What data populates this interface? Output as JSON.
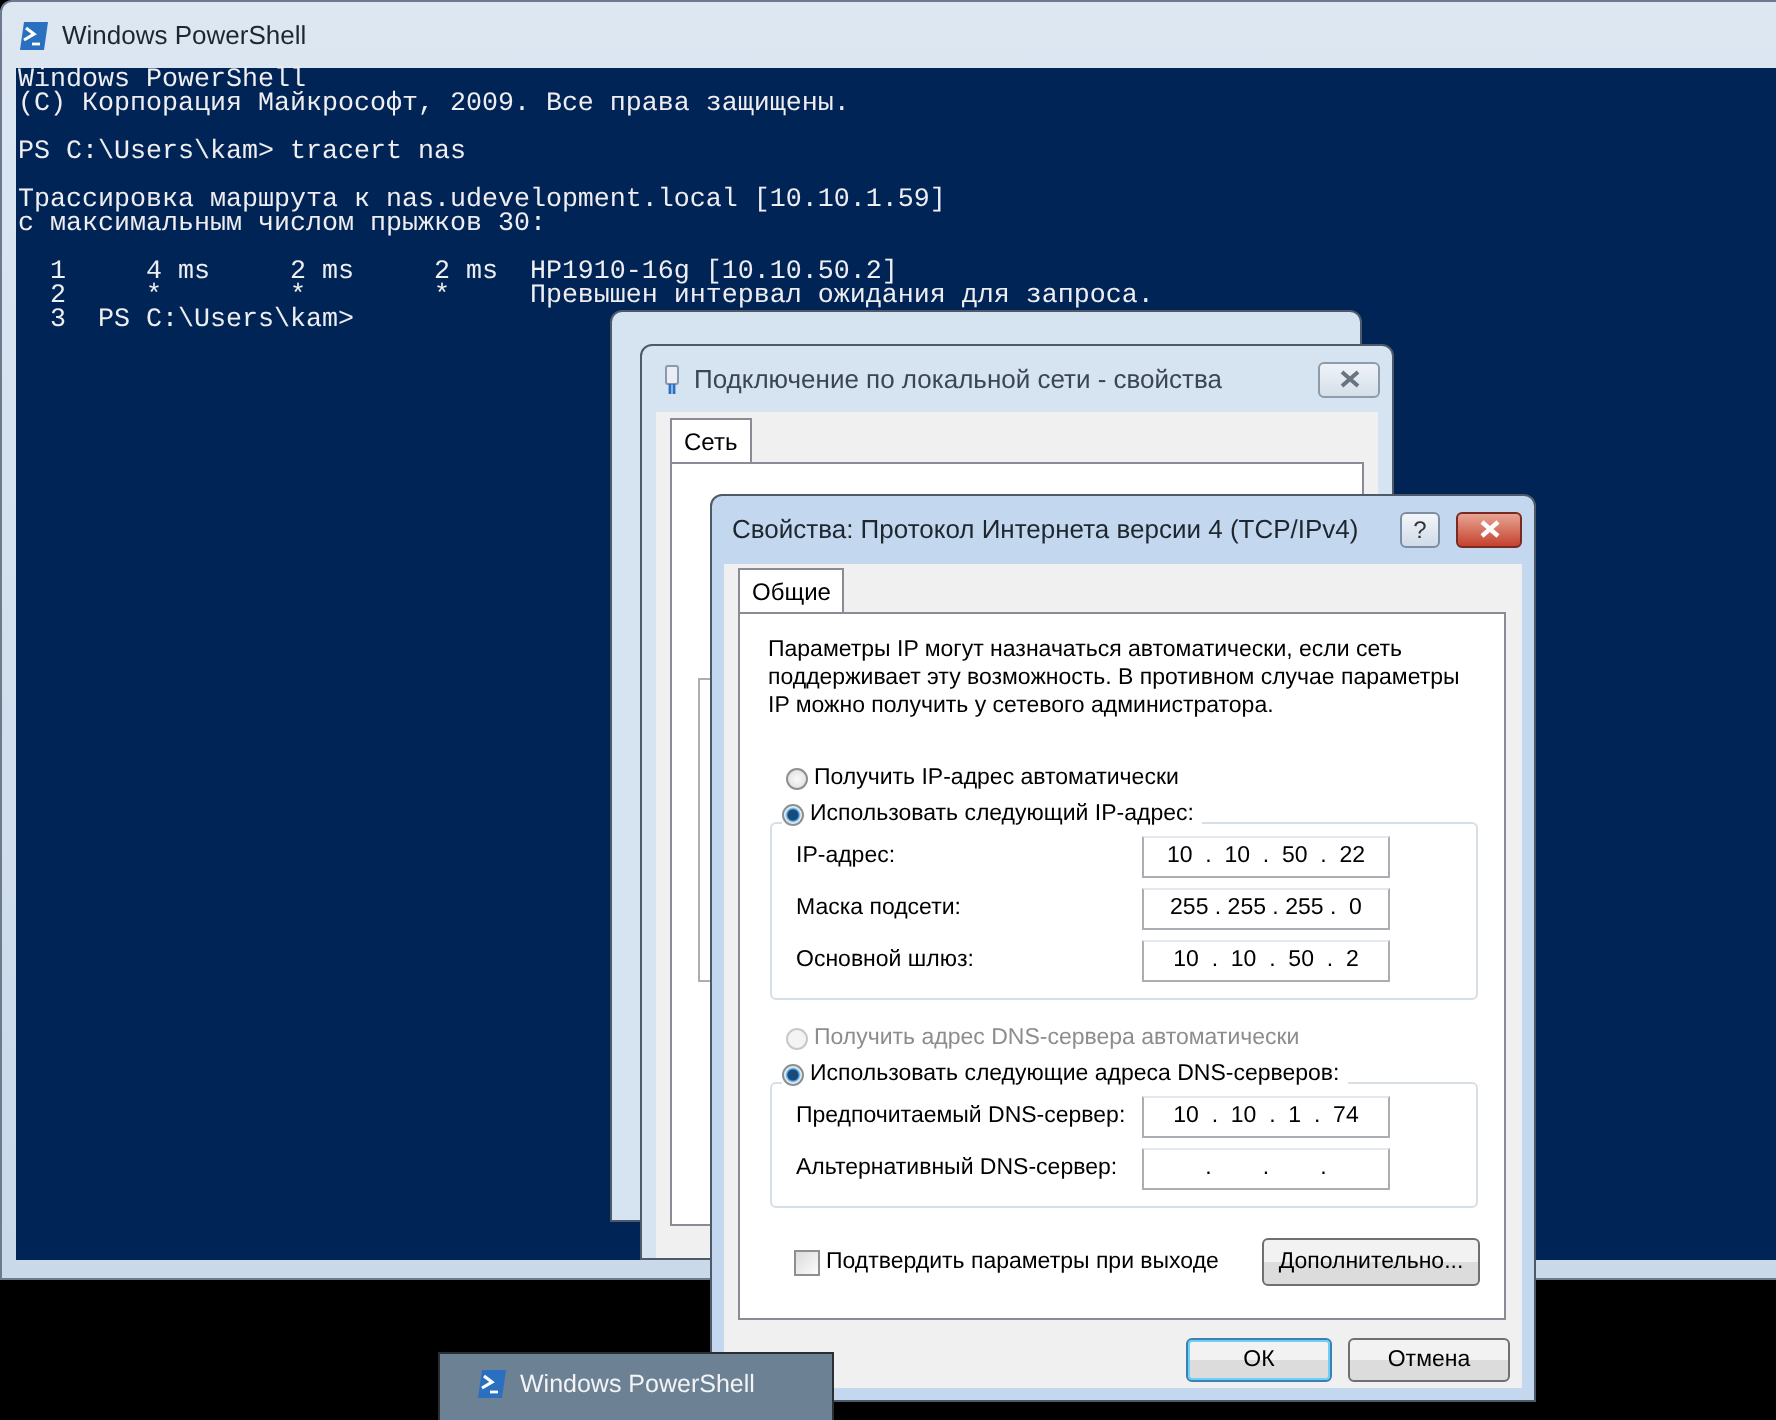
{
  "console_window": {
    "title": "Windows PowerShell",
    "console_blocks": [
      [
        "Windows PowerShell",
        "(C) Корпорация Майкрософт, 2009. Все права защищены."
      ],
      [
        "PS C:\\Users\\kam> tracert nas"
      ],
      [
        "Трассировка маршрута к nas.udevelopment.local [10.10.1.59]",
        "с максимальным числом прыжков 30:"
      ],
      [
        "  1     4 ms     2 ms     2 ms  HP1910-16g [10.10.50.2]",
        "  2     *        *        *     Превышен интервал ожидания для запроса.",
        "  3  PS C:\\Users\\kam>"
      ]
    ]
  },
  "connection_dialog": {
    "title": "Подключение по локальной сети - свойства",
    "tabs": [
      {
        "label": "Сеть",
        "selected": true
      }
    ]
  },
  "ipv4_dialog": {
    "title": "Свойства: Протокол Интернета версии 4 (TCP/IPv4)",
    "help_button": "?",
    "tabs": [
      {
        "label": "Общие",
        "selected": true
      }
    ],
    "description": "Параметры IP могут назначаться автоматически, если сеть поддерживает эту возможность. В противном случае параметры IP можно получить у сетевого администратора.",
    "ip_auto": {
      "label": "Получить IP-адрес автоматически",
      "selected": false,
      "disabled": false
    },
    "ip_manual": {
      "label": "Использовать следующий IP-адрес:",
      "selected": true,
      "disabled": false
    },
    "ip_fields": [
      {
        "label": "IP-адрес:",
        "value": "10  .  10  .  50  .  22"
      },
      {
        "label": "Маска подсети:",
        "value": "255 . 255 . 255 .  0"
      },
      {
        "label": "Основной шлюз:",
        "value": "10  .  10  .  50  .  2"
      }
    ],
    "dns_auto": {
      "label": "Получить адрес DNS-сервера автоматически",
      "selected": false,
      "disabled": true
    },
    "dns_manual": {
      "label": "Использовать следующие адреса DNS-серверов:",
      "selected": true,
      "disabled": false
    },
    "dns_fields": [
      {
        "label": "Предпочитаемый DNS-сервер:",
        "value": "10  .  10  .  1  .  74"
      },
      {
        "label": "Альтернативный DNS-сервер:",
        "value": ".        .        ."
      }
    ],
    "validate_checkbox": {
      "label": "Подтвердить параметры при выходе",
      "checked": false
    },
    "advanced_button": "Дополнительно...",
    "buttons": [
      {
        "label": "ОК",
        "default": true
      },
      {
        "label": "Отмена",
        "default": false
      }
    ]
  },
  "taskbar_preview": {
    "title": "Windows PowerShell"
  }
}
